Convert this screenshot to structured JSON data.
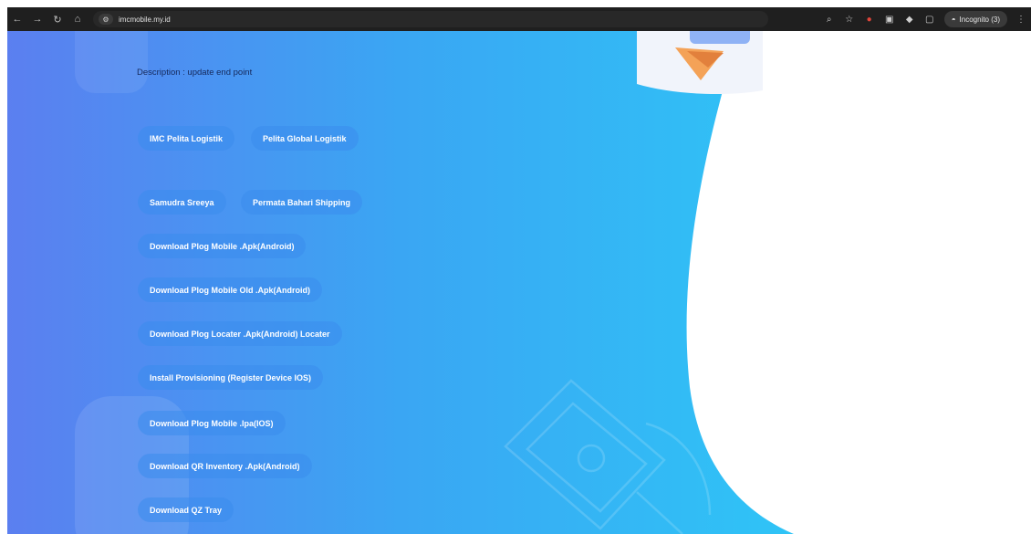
{
  "browser": {
    "url": "imcmobile.my.id",
    "incognito_label": "Incognito (3)"
  },
  "page": {
    "description": "Description : update end point",
    "buttons": [
      "IMC Pelita Logistik",
      "Pelita Global Logistik",
      "Samudra Sreeya",
      "Permata Bahari Shipping",
      "Download Plog Mobile .Apk(Android)",
      "Download Plog Mobile Old .Apk(Android)",
      "Download Plog Locater .Apk(Android) Locater",
      "Install Provisioning (Register Device IOS)",
      "Download Plog Mobile .Ipa(IOS)",
      "Download QR Inventory .Apk(Android)",
      "Download QZ Tray"
    ]
  },
  "colors": {
    "gradient_start": "#5b7ff0",
    "gradient_end": "#2fc4f6",
    "text_dark": "#15285a"
  }
}
